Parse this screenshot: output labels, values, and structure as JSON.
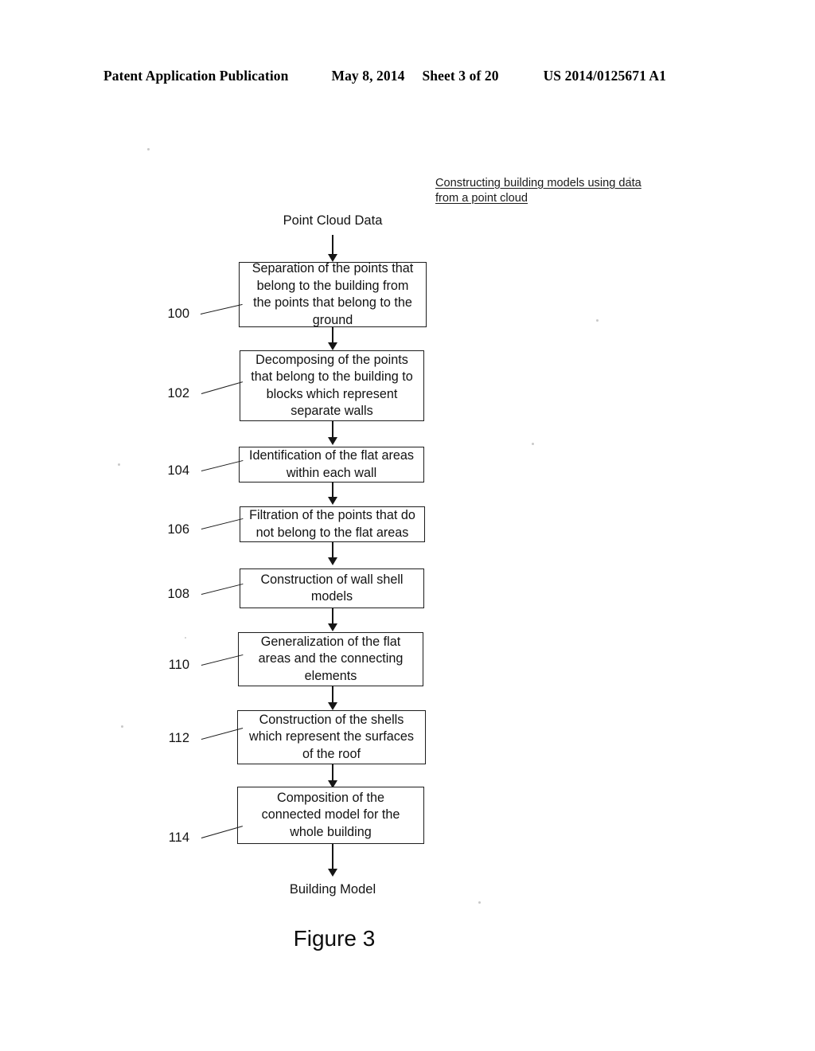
{
  "header": {
    "publication": "Patent Application Publication",
    "date": "May 8, 2014",
    "sheet": "Sheet 3 of 20",
    "patent_number": "US 2014/0125671 A1"
  },
  "figure": {
    "title_line_1": "Constructing building models using data",
    "title_line_2": "from a point cloud",
    "caption": "Figure 3",
    "input_label": "Point Cloud Data",
    "output_label": "Building Model"
  },
  "flowchart": {
    "type": "flowchart",
    "orientation": "vertical",
    "steps": [
      {
        "ref": "100",
        "text": "Separation of the points that belong to the building from the points that belong to the ground",
        "lines": [
          "Separation of the points that",
          "belong to the building from",
          "the points that belong to the",
          "ground"
        ]
      },
      {
        "ref": "102",
        "text": "Decomposing of the points that belong to the building to blocks which represent separate walls",
        "lines": [
          "Decomposing of the points",
          "that belong to the building to",
          "blocks which represent",
          "separate walls"
        ]
      },
      {
        "ref": "104",
        "text": "Identification of the flat areas within each wall",
        "lines": [
          "Identification of the flat areas",
          "within each wall"
        ]
      },
      {
        "ref": "106",
        "text": "Filtration of the points that do not belong to the flat areas",
        "lines": [
          "Filtration of the points that do",
          "not belong to the flat areas"
        ]
      },
      {
        "ref": "108",
        "text": "Construction of wall shell models",
        "lines": [
          "Construction of wall shell",
          "models"
        ]
      },
      {
        "ref": "110",
        "text": "Generalization of the flat areas and the connecting elements",
        "lines": [
          "Generalization of the flat",
          "areas and the connecting",
          "elements"
        ]
      },
      {
        "ref": "112",
        "text": "Construction of the shells which represent the surfaces of the roof",
        "lines": [
          "Construction of the shells",
          "which represent the surfaces",
          "of the roof"
        ]
      },
      {
        "ref": "114",
        "text": "Composition of the connected model for the whole building",
        "lines": [
          "Composition of the",
          "connected model for the",
          "whole building"
        ]
      }
    ]
  },
  "colors": {
    "ink": "#121212",
    "page": "#ffffff"
  }
}
